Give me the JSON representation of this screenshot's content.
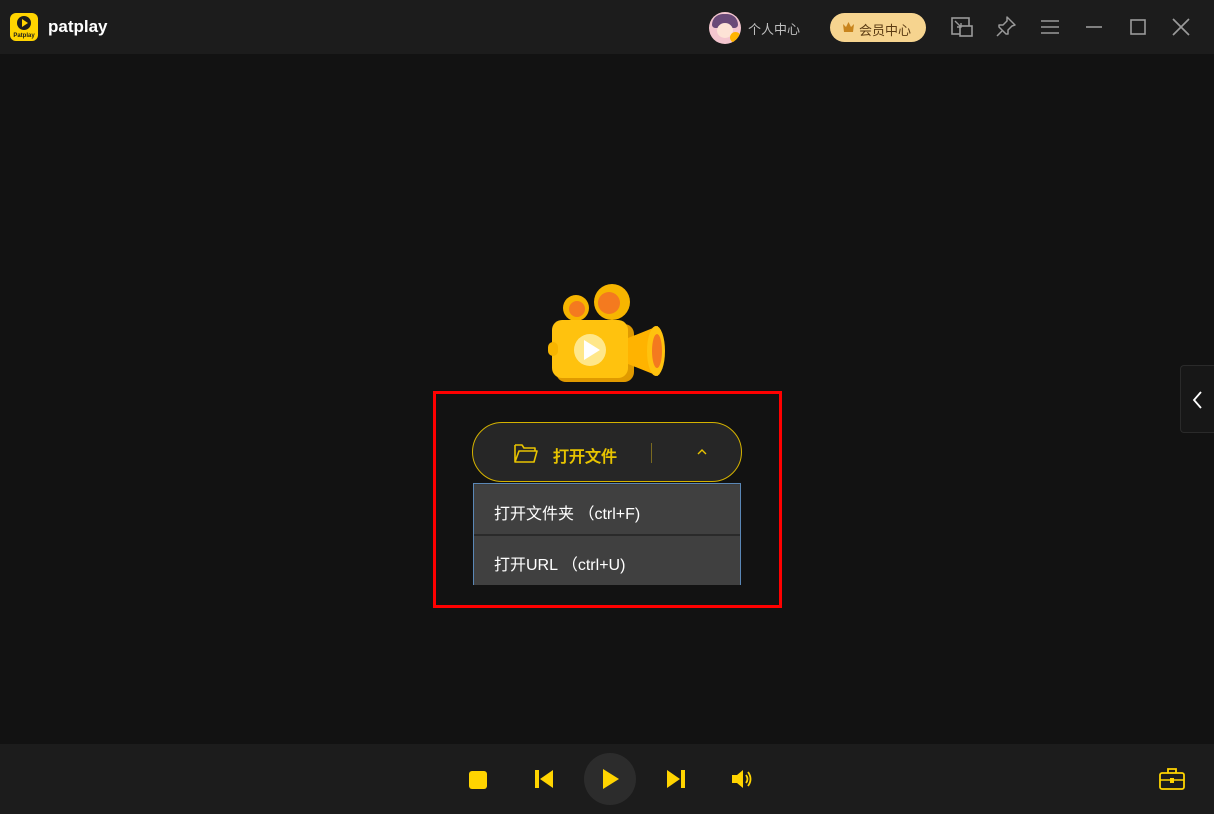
{
  "app": {
    "name": "patplay",
    "logo_text": "Patplay"
  },
  "header": {
    "user_center": "个人中心",
    "vip_center": "会员中心",
    "icons": [
      "mini-mode-icon",
      "pin-icon",
      "menu-icon",
      "minimize-icon",
      "maximize-icon",
      "close-icon"
    ]
  },
  "main": {
    "open_file_label": "打开文件",
    "dropdown": [
      {
        "label": "打开文件夹 （ctrl+F)"
      },
      {
        "label": "打开URL （ctrl+U)"
      }
    ]
  },
  "colors": {
    "accent": "#e8c400",
    "background": "#121212",
    "bar": "#1c1c1c",
    "highlight": "#ff0000"
  }
}
